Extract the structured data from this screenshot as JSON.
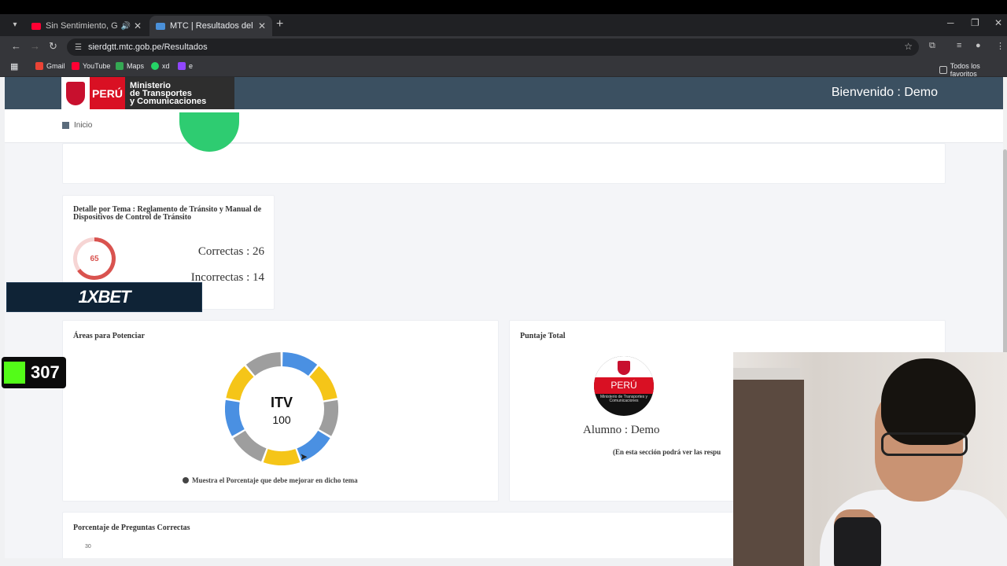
{
  "browser": {
    "tabs": [
      {
        "label": "Sin Sentimiento, Grupo Nic",
        "favicon_color": "#ff0033",
        "audio": true
      },
      {
        "label": "MTC | Resultados del Examen d",
        "favicon_color": "#4a90d9",
        "audio": false
      }
    ],
    "url": "sierdgtt.mtc.gob.pe/Resultados",
    "bookmarks": [
      {
        "label": "Gmail",
        "color": "#ea4335"
      },
      {
        "label": "YouTube",
        "color": "#ff0033"
      },
      {
        "label": "Maps",
        "color": "#34a853"
      },
      {
        "label": "xd",
        "color": "#25d366"
      },
      {
        "label": "e",
        "color": "#9146ff"
      }
    ],
    "all_bookmarks": "Todos los favoritos"
  },
  "site": {
    "brand_peru": "PERÚ",
    "brand_ministry": [
      "Ministerio",
      "de Transportes",
      "y Comunicaciones"
    ],
    "welcome": "Bienvenido : Demo",
    "nav_home": "Inicio"
  },
  "detail": {
    "title": "Detalle por Tema : Reglamento de Tránsito y Manual de Dispositivos de Control de Tránsito",
    "score": "65",
    "score_fraction": 0.65,
    "correct": "Correctas : 26",
    "incorrect": "Incorrectas : 14"
  },
  "areas": {
    "title": "Áreas para Potenciar",
    "center_label": "ITV",
    "center_value": "100",
    "legend": "Muestra el Porcentaje que debe mejorar en dicho tema",
    "segment_colors": [
      "#4a90e2",
      "#f5c518",
      "#9e9e9e",
      "#4a90e2",
      "#f5c518",
      "#9e9e9e",
      "#4a90e2",
      "#f5c518",
      "#9e9e9e"
    ]
  },
  "puntaje": {
    "title": "Puntaje Total",
    "emblem_text": "PERÚ",
    "emblem_sub": "Ministerio de Transportes y Comunicaciones",
    "alumno": "Alumno : Demo",
    "note": "(En esta sección podrá ver las respu"
  },
  "porcentaje": {
    "title": "Porcentaje de Preguntas Correctas",
    "y_tick": "30"
  },
  "overlays": {
    "ad_text": "1XBET",
    "viewer_count": "307"
  }
}
